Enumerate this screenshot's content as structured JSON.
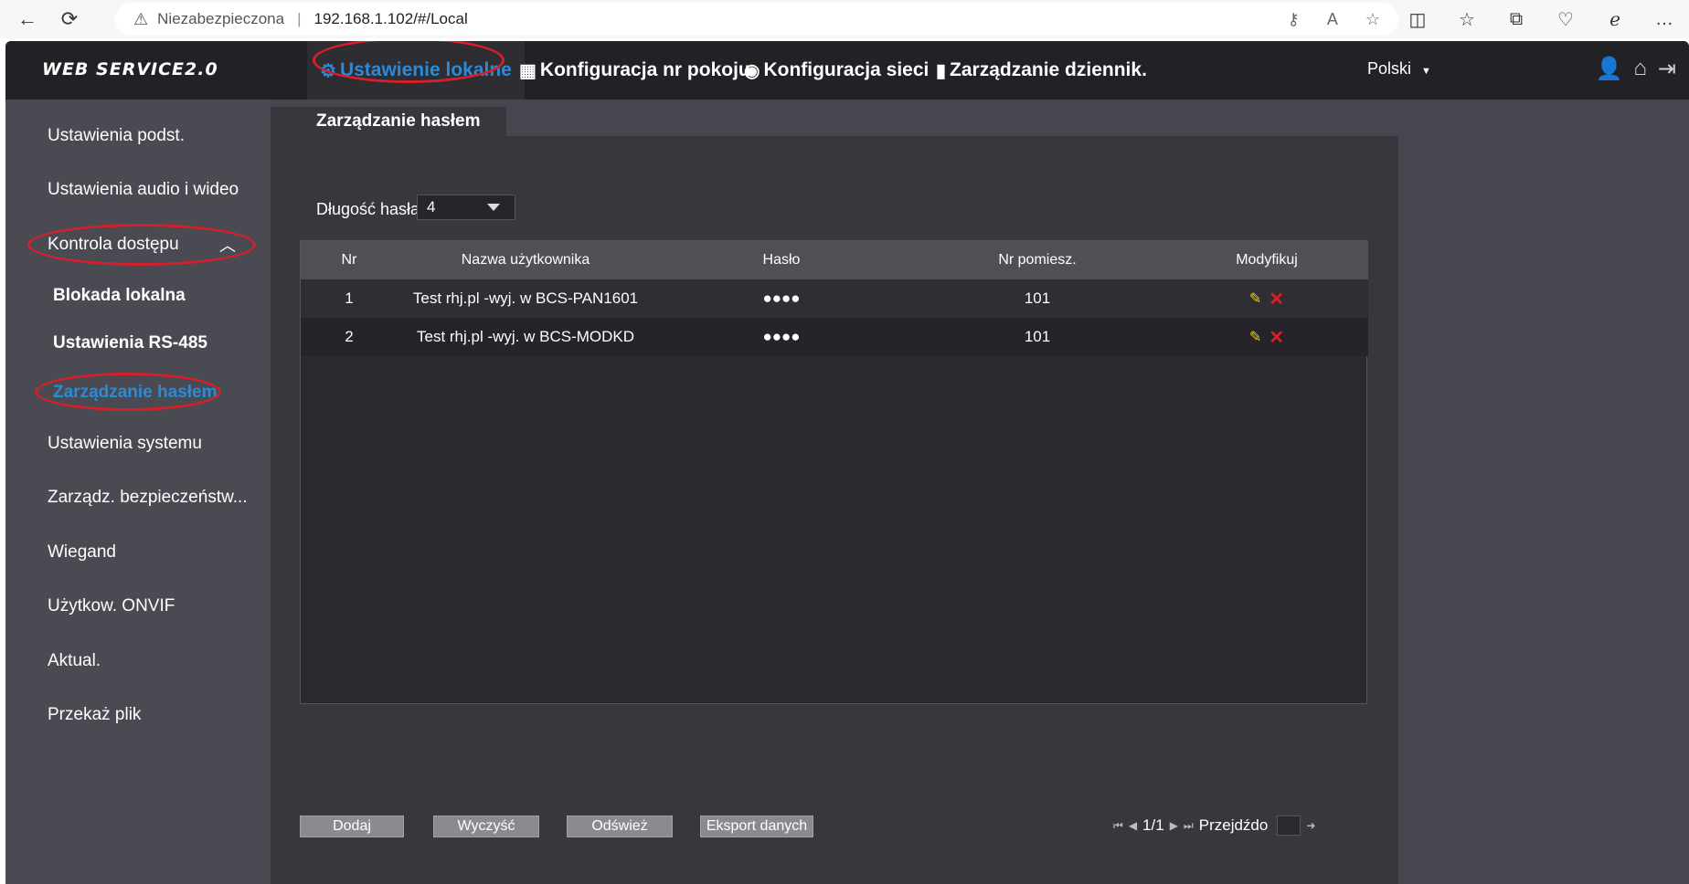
{
  "browser": {
    "warning_text": "Niezabezpieczona",
    "url": "192.168.1.102/#/Local"
  },
  "app": {
    "logo": "WEB SERVICE2.0",
    "nav": [
      {
        "label": "Ustawienie lokalne",
        "icon": "gear-icon"
      },
      {
        "label": "Konfiguracja nr pokoju",
        "icon": "building-icon"
      },
      {
        "label": "Konfiguracja sieci",
        "icon": "globe-icon"
      },
      {
        "label": "Zarządzanie dziennik.",
        "icon": "log-icon"
      }
    ],
    "language": "Polski",
    "accent_color": "#2a8bd8",
    "highlight_color": "#d4202a"
  },
  "sidebar": {
    "items": [
      {
        "label": "Ustawienia podst."
      },
      {
        "label": "Ustawienia audio i wideo"
      },
      {
        "label": "Kontrola dostępu"
      },
      {
        "label": "Blokada lokalna"
      },
      {
        "label": "Ustawienia RS-485"
      },
      {
        "label": "Zarządzanie hasłem"
      },
      {
        "label": "Ustawienia systemu"
      },
      {
        "label": "Zarządz. bezpieczeństw..."
      },
      {
        "label": "Wiegand"
      },
      {
        "label": "Użytkow. ONVIF"
      },
      {
        "label": "Aktual."
      },
      {
        "label": "Przekaż plik"
      }
    ]
  },
  "content": {
    "tab": "Zarządzanie hasłem",
    "password_length_label": "Długość hasła",
    "password_length_value": "4",
    "table": {
      "headers": [
        "Nr",
        "Nazwa użytkownika",
        "Hasło",
        "Nr pomiesz.",
        "Modyfikuj"
      ],
      "rows": [
        {
          "nr": "1",
          "name": "Test rhj.pl -wyj. w BCS-PAN1601",
          "password": "●●●●",
          "room": "101"
        },
        {
          "nr": "2",
          "name": "Test rhj.pl -wyj. w BCS-MODKD",
          "password": "●●●●",
          "room": "101"
        }
      ]
    },
    "buttons": {
      "add": "Dodaj",
      "clear": "Wyczyść",
      "refresh": "Odśwież",
      "export": "Eksport danych"
    },
    "pager": {
      "page": "1/1",
      "goto_label": "Przejdźdo"
    }
  }
}
